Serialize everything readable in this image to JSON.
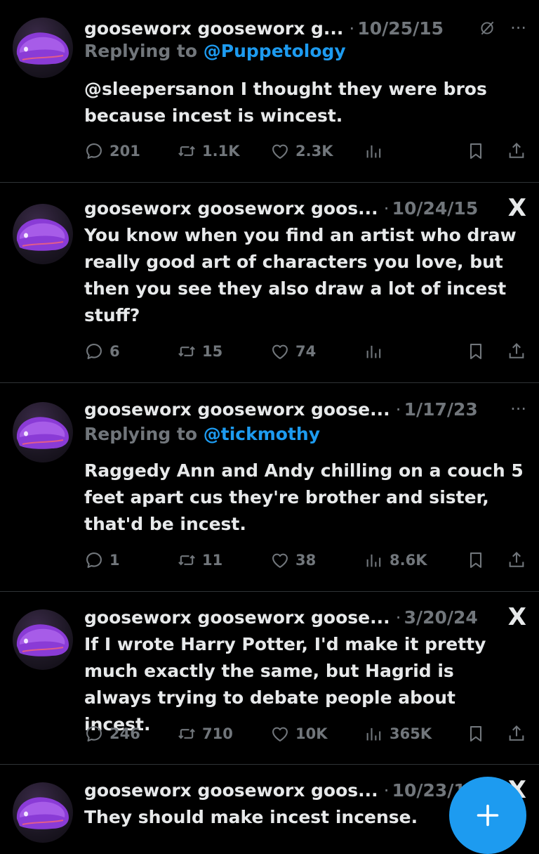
{
  "tweets": [
    {
      "name": "gooseworx gooseworx g...",
      "date": "10/25/15",
      "header_icons": [
        "mute-icon",
        "more-icon"
      ],
      "replying_prefix": "Replying to",
      "replying_to": "@Puppetology",
      "text": "@sleepersanon I thought they were bros because incest is wincest.",
      "replies": "201",
      "retweets": "1.1K",
      "likes": "2.3K",
      "views": ""
    },
    {
      "name": "gooseworx gooseworx goos...",
      "date": "10/24/15",
      "header_icons": [
        "x-logo-icon"
      ],
      "x_logo": "X",
      "text": "You know when you find an artist who draw really good art of characters you love, but then you see they also draw a lot of incest stuff?",
      "replies": "6",
      "retweets": "15",
      "likes": "74",
      "views": ""
    },
    {
      "name": "gooseworx gooseworx goose...",
      "date": "1/17/23",
      "header_icons": [
        "more-icon"
      ],
      "replying_prefix": "Replying to",
      "replying_to": "@tickmothy",
      "text": "Raggedy Ann and Andy chilling on a couch 5 feet apart cus they're brother and sister, that'd be incest.",
      "replies": "1",
      "retweets": "11",
      "likes": "38",
      "views": "8.6K"
    },
    {
      "name": "gooseworx gooseworx goose...",
      "date": "3/20/24",
      "header_icons": [
        "x-logo-icon"
      ],
      "x_logo": "X",
      "text": "If I wrote Harry Potter, I'd make it pretty much exactly the same, but Hagrid is always trying to debate people about incest.",
      "replies": "246",
      "retweets": "710",
      "likes": "10K",
      "views": "365K"
    },
    {
      "name": "gooseworx gooseworx goos...",
      "date": "10/23/1",
      "header_icons": [
        "x-logo-icon"
      ],
      "x_logo": "X",
      "text": "They should make incest incense."
    }
  ],
  "separator": "·",
  "more_glyph": "···",
  "fab": {
    "icon": "plus-icon",
    "color": "#1d9bf0"
  },
  "colors": {
    "background": "#000000",
    "text": "#e7e9ea",
    "muted": "#71767b",
    "link": "#1d9bf0"
  }
}
